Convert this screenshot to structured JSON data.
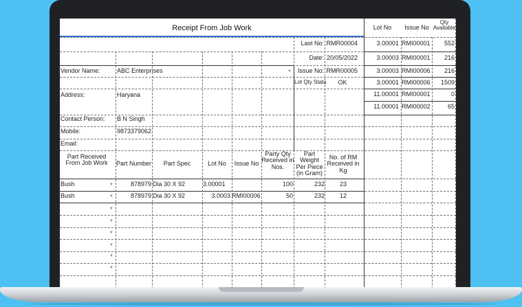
{
  "title": "Receipt From Job Work",
  "side_headers": [
    "Lot No",
    "Issue No",
    "Qty Available"
  ],
  "side_rows": [
    [
      "3.00001",
      "RMI00001",
      "552"
    ],
    [
      "3.00003",
      "RMI00001",
      "216"
    ],
    [
      "3.00003",
      "RMI00006",
      "216"
    ],
    [
      "3.00001",
      "RMI00006",
      "1509"
    ],
    [
      "11.00001",
      "RMI00001",
      "0"
    ],
    [
      "11.00001",
      "RMI00002",
      "65"
    ]
  ],
  "info": {
    "last_no_label": "Last No:",
    "last_no_value": "RMR00004",
    "date_label": "Date:",
    "date_value": "20/05/2022",
    "issue_no_label": "Issue No:",
    "issue_no_value": "RMR00005",
    "qty_status_label": "Lot Qty Status",
    "qty_status_value": "OK"
  },
  "vendor": {
    "vendor_label": "Vendor Name:",
    "vendor_value": "ABC Enterprises",
    "address_label": "Address:",
    "address_value": "Haryana",
    "contact_label": "Contact Person:",
    "contact_value": "B N Singh",
    "mobile_label": "Mobile:",
    "mobile_value": "9873379062",
    "email_label": "Email:"
  },
  "table_headers": {
    "part_received": "Part Received From Job Work",
    "part_number": "Part Number",
    "part_spec": "Part Spec",
    "lot_no": "Lot No",
    "issue_no": "Issue No",
    "party_qty": "Party Qty Received in Nos.",
    "part_weight": "Part Weight Per Piece (in Gram)",
    "rm_received": "No. of RM Received in Kg"
  },
  "table_rows": [
    {
      "part": "Bush",
      "part_number": "878979",
      "spec": "Dia 30 X 92",
      "lot": "3.00001",
      "issue": "",
      "qty": "100",
      "weight": "232",
      "rm": "23"
    },
    {
      "part": "Bush",
      "part_number": "878979",
      "spec": "Dia 30 X 92",
      "lot": "3.0003",
      "issue": "RMI00006",
      "qty": "50",
      "weight": "232",
      "rm": "12"
    }
  ],
  "dropdown_glyph": "▼"
}
